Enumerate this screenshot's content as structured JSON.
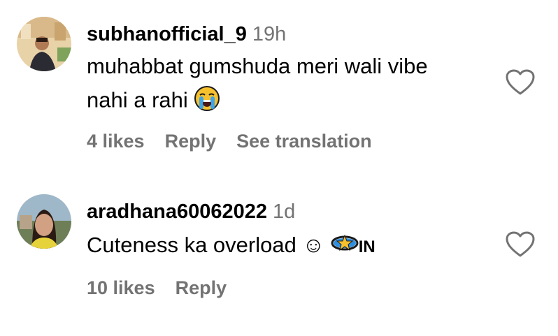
{
  "comments": [
    {
      "username": "subhanofficial_9",
      "time": "19h",
      "text_line1": "muhabbat gumshuda meri wali vibe",
      "text_line2": "nahi a rahi",
      "emoji": "loudly-crying-face",
      "likes": "4 likes",
      "reply": "Reply",
      "translate": "See translation"
    },
    {
      "username": "aradhana60062022",
      "time": "1d",
      "text": "Cuteness ka overload ☺",
      "badge_text": "IN",
      "likes": "10 likes",
      "reply": "Reply"
    }
  ],
  "colors": {
    "text": "#000000",
    "secondary": "#737373",
    "heart_outline": "#737373"
  },
  "icons": {
    "like": "heart-outline-icon",
    "emoji1": "loudly-crying-face-icon",
    "emoji2": "dizzy-star-icon"
  }
}
